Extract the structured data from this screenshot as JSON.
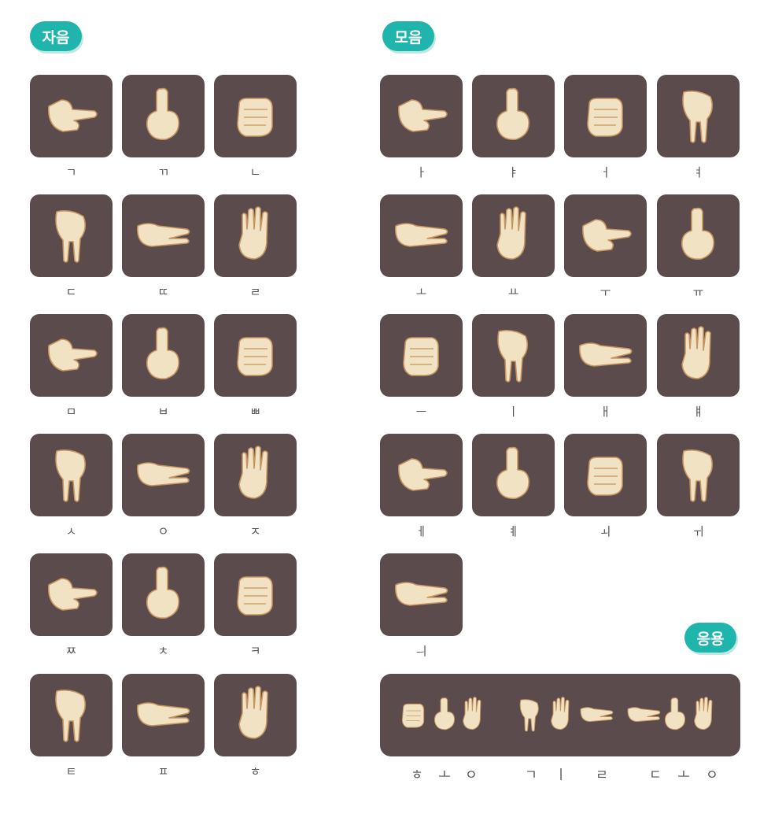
{
  "sections": {
    "consonants_title": "자음",
    "vowels_title": "모음",
    "application_title": "응용"
  },
  "consonants": [
    "ㄱ",
    "ㄲ",
    "ㄴ",
    "ㄷ",
    "ㄸ",
    "ㄹ",
    "ㅁ",
    "ㅂ",
    "ㅃ",
    "ㅅ",
    "ㅇ",
    "ㅈ",
    "ㅉ",
    "ㅊ",
    "ㅋ",
    "ㅌ",
    "ㅍ",
    "ㅎ"
  ],
  "vowels": [
    "ㅏ",
    "ㅑ",
    "ㅓ",
    "ㅕ",
    "ㅗ",
    "ㅛ",
    "ㅜ",
    "ㅠ",
    "ㅡ",
    "ㅣ",
    "ㅐ",
    "ㅒ",
    "ㅔ",
    "ㅖ",
    "ㅚ",
    "ㅟ",
    "ㅢ"
  ],
  "application": {
    "letters": [
      "ㅎ",
      "ㅗ",
      "ㅇ",
      "ㄱ",
      "ㅣ",
      "ㄹ",
      "ㄷ",
      "ㅗ",
      "ㅇ"
    ]
  },
  "colors": {
    "badge": "#1fb5ad",
    "tile": "#5c4b4d",
    "hand": "#f2e2c4",
    "hand_outline": "#c4955f"
  },
  "icons": {
    "hand": "hand-sign-icon"
  }
}
